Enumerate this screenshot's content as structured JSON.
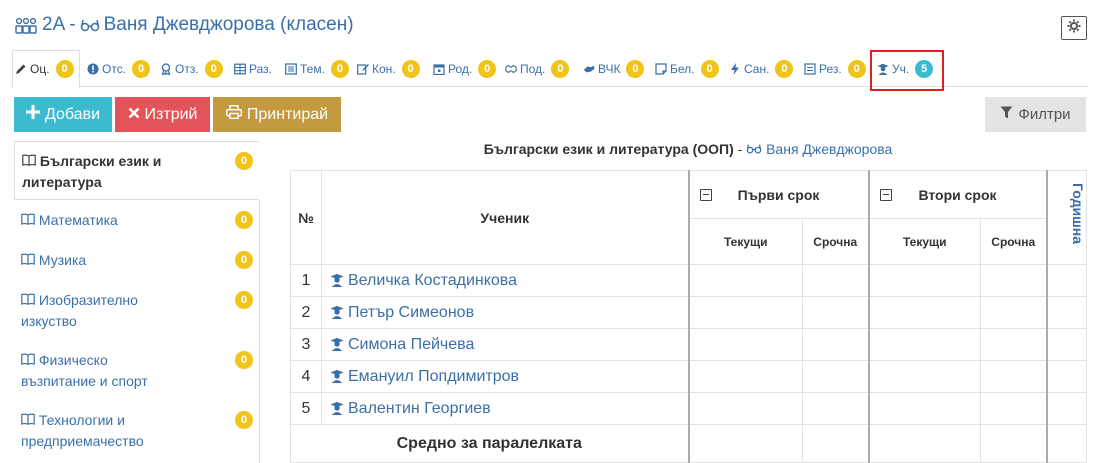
{
  "header": {
    "title_class": "2А",
    "title_separator": "-",
    "title_teacher": "Ваня Джевджорова (класен)"
  },
  "tabs": [
    {
      "label": "Оц.",
      "count": "0",
      "icon": "pencil-icon"
    },
    {
      "label": "Отс.",
      "count": "0",
      "icon": "exclamation-circle-icon"
    },
    {
      "label": "Отз.",
      "count": "0",
      "icon": "award-icon"
    },
    {
      "label": "Раз.",
      "count": "",
      "icon": "table-icon"
    },
    {
      "label": "Тем.",
      "count": "0",
      "icon": "list-icon"
    },
    {
      "label": "Кон.",
      "count": "0",
      "icon": "edit-icon"
    },
    {
      "label": "Род.",
      "count": "0",
      "icon": "calendar-icon"
    },
    {
      "label": "Под.",
      "count": "0",
      "icon": "handshake-icon"
    },
    {
      "label": "ВЧК",
      "count": "0",
      "icon": "hands-icon"
    },
    {
      "label": "Бел.",
      "count": "0",
      "icon": "note-icon"
    },
    {
      "label": "Сан.",
      "count": "0",
      "icon": "bolt-icon"
    },
    {
      "label": "Рез.",
      "count": "0",
      "icon": "file-icon"
    },
    {
      "label": "Уч.",
      "count": "5",
      "icon": "graduate-icon"
    }
  ],
  "toolbar": {
    "add_label": "Добави",
    "delete_label": "Изтрий",
    "print_label": "Принтирай",
    "filter_label": "Филтри"
  },
  "subjects": [
    {
      "line1": "Български език и",
      "line2": "литература",
      "count": "0"
    },
    {
      "line1": "Математика",
      "line2": "",
      "count": "0"
    },
    {
      "line1": "Музика",
      "line2": "",
      "count": "0"
    },
    {
      "line1": "Изобразително",
      "line2": "изкуство",
      "count": "0"
    },
    {
      "line1": "Физическо",
      "line2": "възпитание и спорт",
      "count": "0"
    },
    {
      "line1": "Технологии и",
      "line2": "предприемачество",
      "count": "0"
    }
  ],
  "caption": {
    "subject": "Български език и литература (ООП)",
    "separator": " - ",
    "teacher": "Ваня Джевджорова"
  },
  "table": {
    "col_num": "№",
    "col_student": "Ученик",
    "term1": "Първи срок",
    "term2": "Втори срок",
    "current": "Текущи",
    "term_grade": "Срочна",
    "yearly": "Годишна",
    "students": [
      {
        "n": "1",
        "name": "Величка Костадинкова"
      },
      {
        "n": "2",
        "name": "Петър Симеонов"
      },
      {
        "n": "3",
        "name": "Симона Пейчева"
      },
      {
        "n": "4",
        "name": "Емануил Попдимитров"
      },
      {
        "n": "5",
        "name": "Валентин Георгиев"
      }
    ],
    "average_label": "Средно за паралелката"
  },
  "colors": {
    "link": "#3a6fa8",
    "badge_yellow": "#f0c419",
    "badge_teal": "#3bbad0",
    "add": "#3bbad0",
    "delete": "#e25459",
    "print": "#c39a40",
    "highlight": "#e02020"
  }
}
